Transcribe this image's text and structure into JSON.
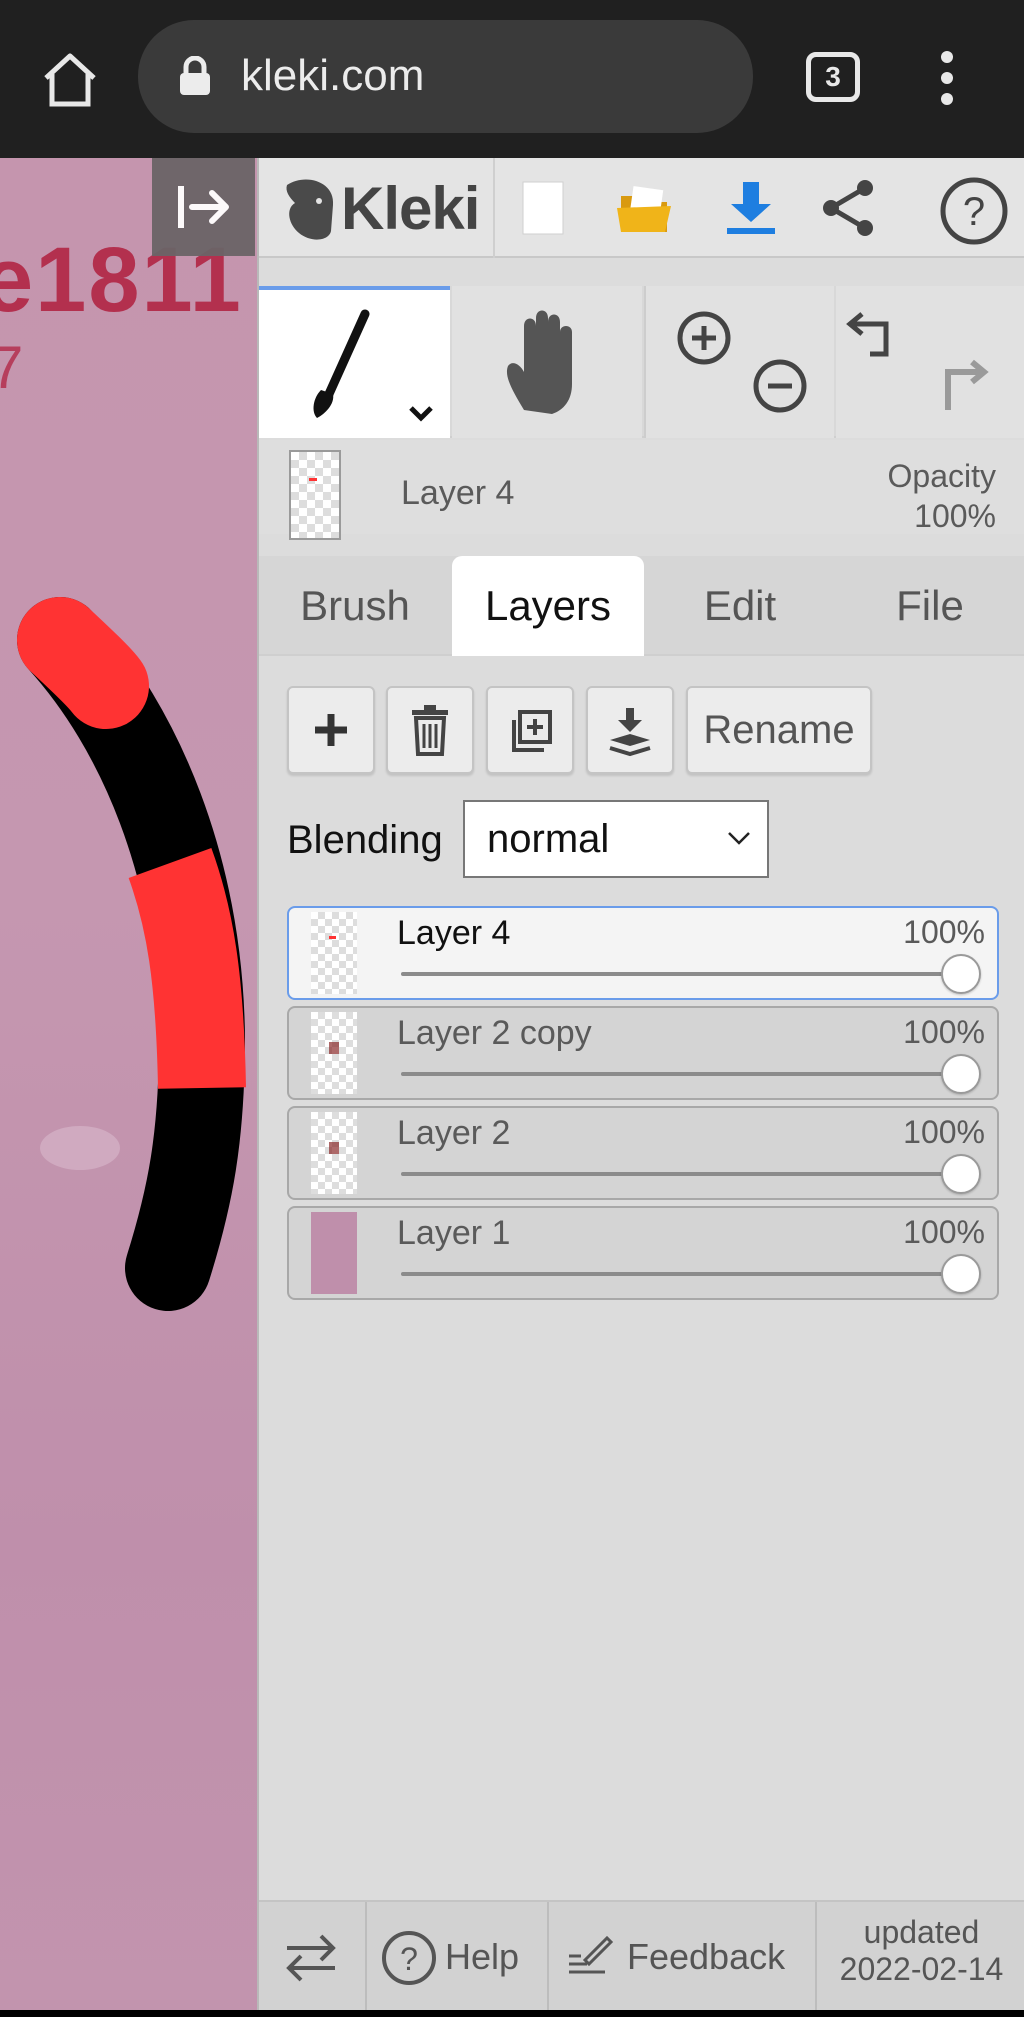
{
  "browser": {
    "url": "kleki.com",
    "tab_count": "3"
  },
  "canvas": {
    "visible_text": "e1811",
    "visible_text2": "7"
  },
  "app": {
    "logo_text": "Kleki"
  },
  "current_layer": {
    "name": "Layer 4",
    "opacity_label": "Opacity",
    "opacity_value": "100%"
  },
  "tabs": [
    {
      "label": "Brush"
    },
    {
      "label": "Layers"
    },
    {
      "label": "Edit"
    },
    {
      "label": "File"
    }
  ],
  "layer_buttons": {
    "rename_label": "Rename"
  },
  "blending": {
    "label": "Blending",
    "value": "normal"
  },
  "layers": [
    {
      "name": "Layer 4",
      "opacity": "100%"
    },
    {
      "name": "Layer 2 copy",
      "opacity": "100%"
    },
    {
      "name": "Layer 2",
      "opacity": "100%"
    },
    {
      "name": "Layer 1",
      "opacity": "100%"
    }
  ],
  "footer": {
    "help_label": "Help",
    "feedback_label": "Feedback",
    "updated_label": "updated",
    "updated_date": "2022-02-14"
  },
  "colors": {
    "accent": "#6a9cea",
    "download_icon": "#1e7ee0",
    "folder_icon": "#f0b419",
    "stroke_red": "#ff3333",
    "canvas_bg": "#c595ae"
  }
}
